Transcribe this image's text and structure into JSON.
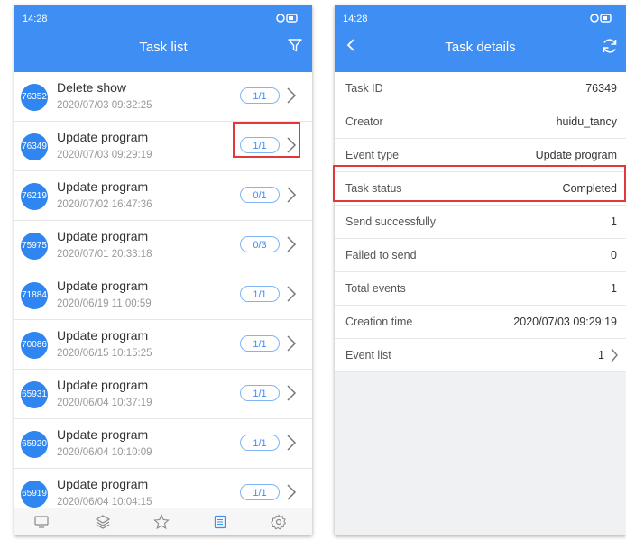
{
  "left": {
    "status_time": "14:28",
    "title": "Task list",
    "tasks": [
      {
        "id": "76352",
        "name": "Delete show",
        "date": "2020/07/03 09:32:25",
        "progress": "1/1"
      },
      {
        "id": "76349",
        "name": "Update program",
        "date": "2020/07/03 09:29:19",
        "progress": "1/1"
      },
      {
        "id": "76219",
        "name": "Update program",
        "date": "2020/07/02 16:47:36",
        "progress": "0/1"
      },
      {
        "id": "75975",
        "name": "Update program",
        "date": "2020/07/01 20:33:18",
        "progress": "0/3"
      },
      {
        "id": "71884",
        "name": "Update program",
        "date": "2020/06/19 11:00:59",
        "progress": "1/1"
      },
      {
        "id": "70086",
        "name": "Update program",
        "date": "2020/06/15 10:15:25",
        "progress": "1/1"
      },
      {
        "id": "65931",
        "name": "Update program",
        "date": "2020/06/04 10:37:19",
        "progress": "1/1"
      },
      {
        "id": "65920",
        "name": "Update program",
        "date": "2020/06/04 10:10:09",
        "progress": "1/1"
      },
      {
        "id": "65919",
        "name": "Update program",
        "date": "2020/06/04 10:04:15",
        "progress": "1/1"
      }
    ],
    "bottom_nav": [
      "monitor-icon",
      "layers-icon",
      "star-icon",
      "list-icon",
      "settings-icon"
    ]
  },
  "right": {
    "status_time": "14:28",
    "title": "Task details",
    "rows": [
      {
        "label": "Task ID",
        "value": "76349"
      },
      {
        "label": "Creator",
        "value": "huidu_tancy"
      },
      {
        "label": "Event type",
        "value": "Update program"
      },
      {
        "label": "Task status",
        "value": "Completed"
      },
      {
        "label": "Send successfully",
        "value": "1"
      },
      {
        "label": "Failed to send",
        "value": "0"
      },
      {
        "label": "Total events",
        "value": "1"
      },
      {
        "label": "Creation time",
        "value": "2020/07/03 09:29:19"
      },
      {
        "label": "Event list",
        "value": "1"
      }
    ]
  },
  "colors": {
    "accent": "#3f8ef3",
    "highlight": "#e2383a",
    "avatar": "#2f86f0"
  }
}
